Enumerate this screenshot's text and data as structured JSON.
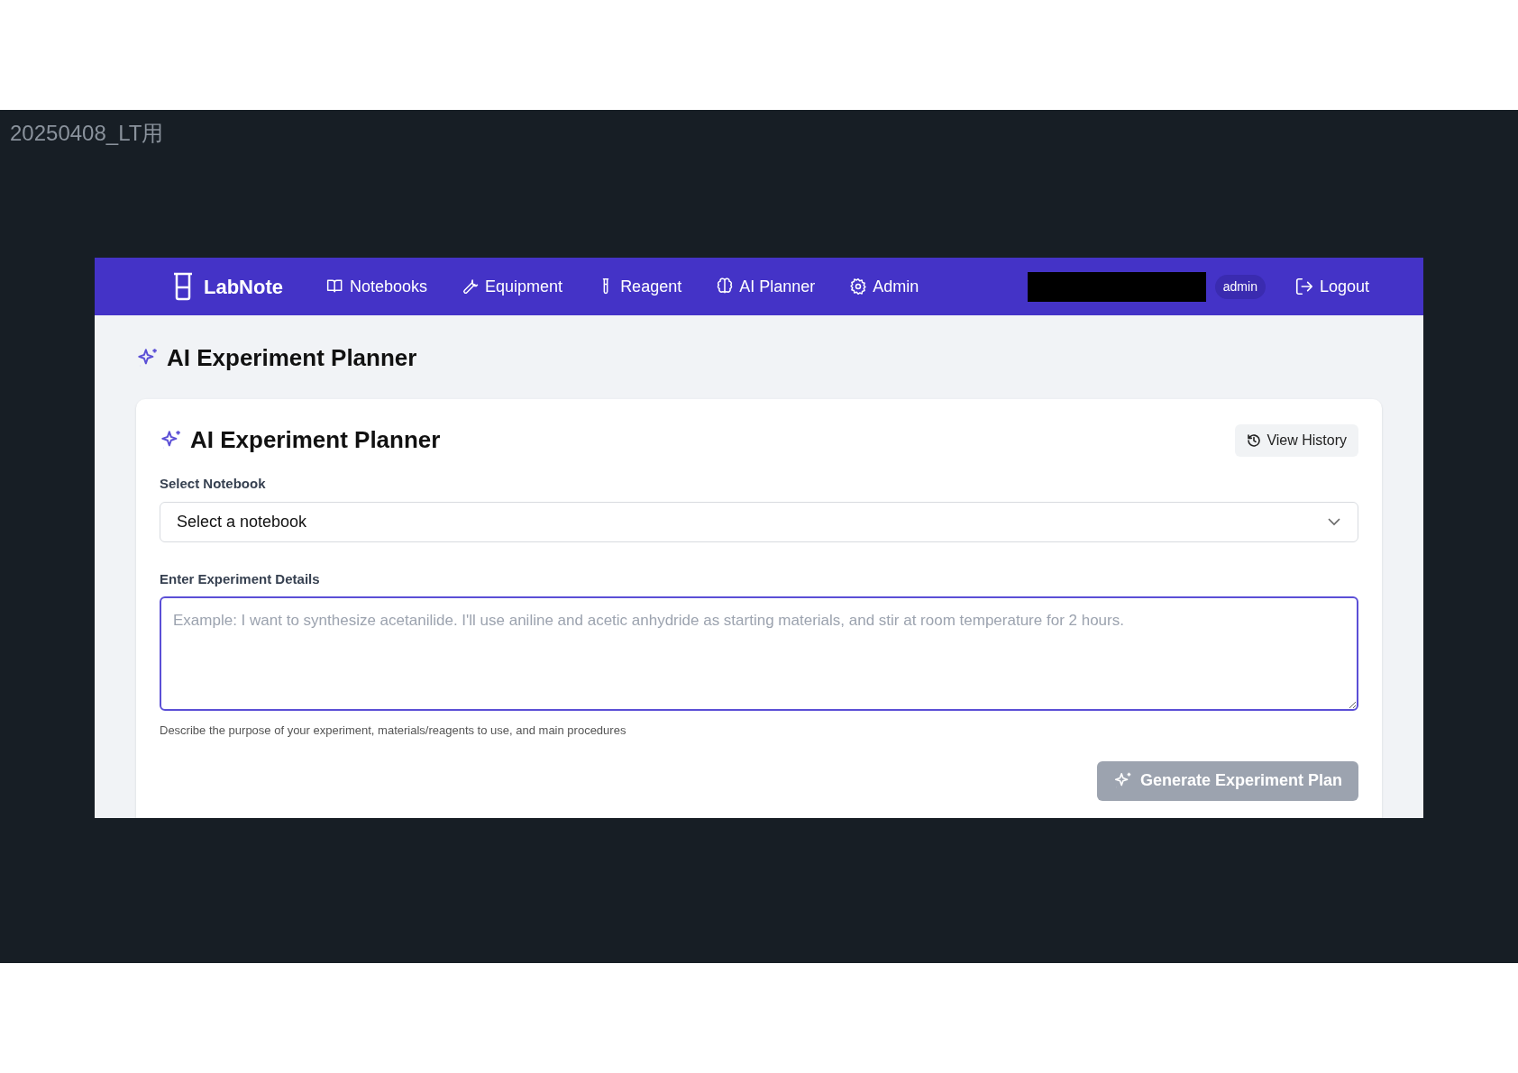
{
  "slide_title": "20250408_LT用",
  "nav": {
    "brand": "LabNote",
    "items": [
      {
        "label": "Notebooks"
      },
      {
        "label": "Equipment"
      },
      {
        "label": "Reagent"
      },
      {
        "label": "AI Planner"
      },
      {
        "label": "Admin"
      }
    ],
    "role_badge": "admin",
    "logout": "Logout"
  },
  "page_title": "AI Experiment Planner",
  "card": {
    "title": "AI Experiment Planner",
    "view_history": "View History",
    "notebook_label": "Select Notebook",
    "notebook_value": "Select a notebook",
    "details_label": "Enter Experiment Details",
    "details_placeholder": "Example: I want to synthesize acetanilide. I'll use aniline and acetic anhydride as starting materials, and stir at room temperature for 2 hours.",
    "details_focused": true,
    "help": "Describe the purpose of your experiment, materials/reagents to use, and main procedures",
    "generate": {
      "label": "Generate Experiment Plan",
      "disabled": true
    }
  }
}
